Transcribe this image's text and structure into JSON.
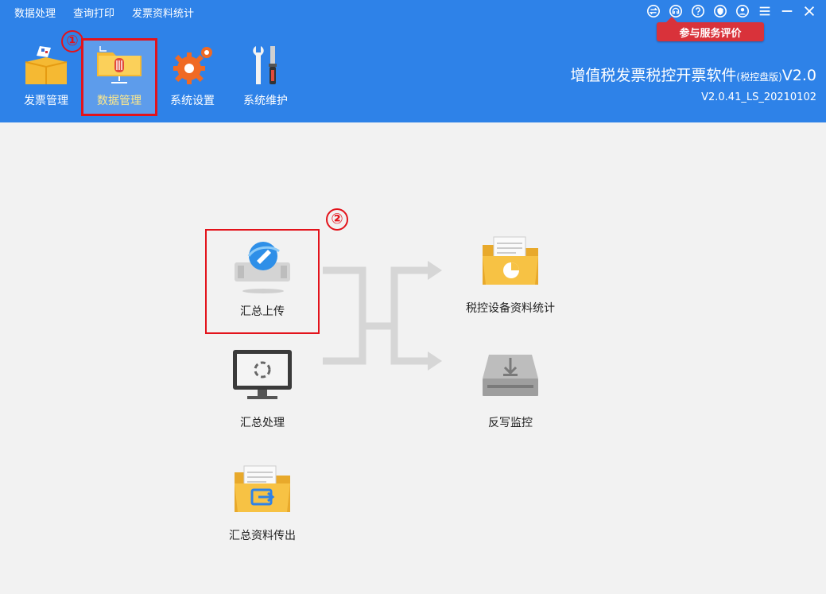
{
  "menu": [
    "数据处理",
    "查询打印",
    "发票资料统计"
  ],
  "review_badge": "参与服务评价",
  "toolbar": [
    {
      "label": "发票管理"
    },
    {
      "label": "数据管理"
    },
    {
      "label": "系统设置"
    },
    {
      "label": "系统维护"
    }
  ],
  "app": {
    "name": "增值税发票税控开票软件",
    "edition": "(税控盘版)",
    "version_suffix": "V2.0",
    "build": "V2.0.41_LS_20210102"
  },
  "markers": {
    "one": "①",
    "two": "②"
  },
  "items": {
    "upload": "汇总上传",
    "process": "汇总处理",
    "export": "汇总资料传出",
    "stats": "税控设备资料统计",
    "writeback": "反写监控"
  },
  "colors": {
    "header": "#2e82e8",
    "highlight": "#e3131b",
    "background": "#f2f2f2"
  }
}
